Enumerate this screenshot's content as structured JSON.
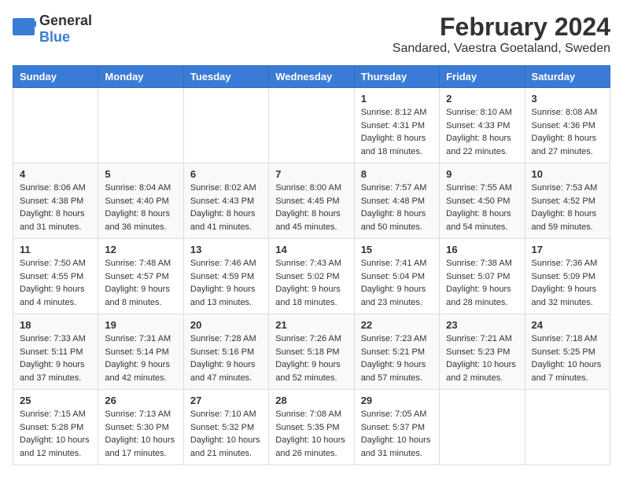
{
  "logo": {
    "general": "General",
    "blue": "Blue"
  },
  "header": {
    "month_year": "February 2024",
    "location": "Sandared, Vaestra Goetaland, Sweden"
  },
  "weekdays": [
    "Sunday",
    "Monday",
    "Tuesday",
    "Wednesday",
    "Thursday",
    "Friday",
    "Saturday"
  ],
  "weeks": [
    [
      {
        "day": "",
        "info": ""
      },
      {
        "day": "",
        "info": ""
      },
      {
        "day": "",
        "info": ""
      },
      {
        "day": "",
        "info": ""
      },
      {
        "day": "1",
        "info": "Sunrise: 8:12 AM\nSunset: 4:31 PM\nDaylight: 8 hours\nand 18 minutes."
      },
      {
        "day": "2",
        "info": "Sunrise: 8:10 AM\nSunset: 4:33 PM\nDaylight: 8 hours\nand 22 minutes."
      },
      {
        "day": "3",
        "info": "Sunrise: 8:08 AM\nSunset: 4:36 PM\nDaylight: 8 hours\nand 27 minutes."
      }
    ],
    [
      {
        "day": "4",
        "info": "Sunrise: 8:06 AM\nSunset: 4:38 PM\nDaylight: 8 hours\nand 31 minutes."
      },
      {
        "day": "5",
        "info": "Sunrise: 8:04 AM\nSunset: 4:40 PM\nDaylight: 8 hours\nand 36 minutes."
      },
      {
        "day": "6",
        "info": "Sunrise: 8:02 AM\nSunset: 4:43 PM\nDaylight: 8 hours\nand 41 minutes."
      },
      {
        "day": "7",
        "info": "Sunrise: 8:00 AM\nSunset: 4:45 PM\nDaylight: 8 hours\nand 45 minutes."
      },
      {
        "day": "8",
        "info": "Sunrise: 7:57 AM\nSunset: 4:48 PM\nDaylight: 8 hours\nand 50 minutes."
      },
      {
        "day": "9",
        "info": "Sunrise: 7:55 AM\nSunset: 4:50 PM\nDaylight: 8 hours\nand 54 minutes."
      },
      {
        "day": "10",
        "info": "Sunrise: 7:53 AM\nSunset: 4:52 PM\nDaylight: 8 hours\nand 59 minutes."
      }
    ],
    [
      {
        "day": "11",
        "info": "Sunrise: 7:50 AM\nSunset: 4:55 PM\nDaylight: 9 hours\nand 4 minutes."
      },
      {
        "day": "12",
        "info": "Sunrise: 7:48 AM\nSunset: 4:57 PM\nDaylight: 9 hours\nand 8 minutes."
      },
      {
        "day": "13",
        "info": "Sunrise: 7:46 AM\nSunset: 4:59 PM\nDaylight: 9 hours\nand 13 minutes."
      },
      {
        "day": "14",
        "info": "Sunrise: 7:43 AM\nSunset: 5:02 PM\nDaylight: 9 hours\nand 18 minutes."
      },
      {
        "day": "15",
        "info": "Sunrise: 7:41 AM\nSunset: 5:04 PM\nDaylight: 9 hours\nand 23 minutes."
      },
      {
        "day": "16",
        "info": "Sunrise: 7:38 AM\nSunset: 5:07 PM\nDaylight: 9 hours\nand 28 minutes."
      },
      {
        "day": "17",
        "info": "Sunrise: 7:36 AM\nSunset: 5:09 PM\nDaylight: 9 hours\nand 32 minutes."
      }
    ],
    [
      {
        "day": "18",
        "info": "Sunrise: 7:33 AM\nSunset: 5:11 PM\nDaylight: 9 hours\nand 37 minutes."
      },
      {
        "day": "19",
        "info": "Sunrise: 7:31 AM\nSunset: 5:14 PM\nDaylight: 9 hours\nand 42 minutes."
      },
      {
        "day": "20",
        "info": "Sunrise: 7:28 AM\nSunset: 5:16 PM\nDaylight: 9 hours\nand 47 minutes."
      },
      {
        "day": "21",
        "info": "Sunrise: 7:26 AM\nSunset: 5:18 PM\nDaylight: 9 hours\nand 52 minutes."
      },
      {
        "day": "22",
        "info": "Sunrise: 7:23 AM\nSunset: 5:21 PM\nDaylight: 9 hours\nand 57 minutes."
      },
      {
        "day": "23",
        "info": "Sunrise: 7:21 AM\nSunset: 5:23 PM\nDaylight: 10 hours\nand 2 minutes."
      },
      {
        "day": "24",
        "info": "Sunrise: 7:18 AM\nSunset: 5:25 PM\nDaylight: 10 hours\nand 7 minutes."
      }
    ],
    [
      {
        "day": "25",
        "info": "Sunrise: 7:15 AM\nSunset: 5:28 PM\nDaylight: 10 hours\nand 12 minutes."
      },
      {
        "day": "26",
        "info": "Sunrise: 7:13 AM\nSunset: 5:30 PM\nDaylight: 10 hours\nand 17 minutes."
      },
      {
        "day": "27",
        "info": "Sunrise: 7:10 AM\nSunset: 5:32 PM\nDaylight: 10 hours\nand 21 minutes."
      },
      {
        "day": "28",
        "info": "Sunrise: 7:08 AM\nSunset: 5:35 PM\nDaylight: 10 hours\nand 26 minutes."
      },
      {
        "day": "29",
        "info": "Sunrise: 7:05 AM\nSunset: 5:37 PM\nDaylight: 10 hours\nand 31 minutes."
      },
      {
        "day": "",
        "info": ""
      },
      {
        "day": "",
        "info": ""
      }
    ]
  ]
}
